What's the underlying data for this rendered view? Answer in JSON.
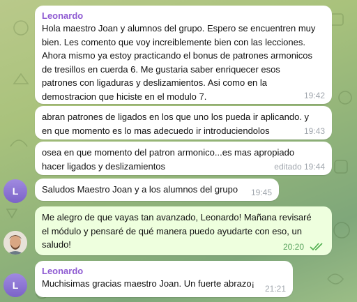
{
  "messages": [
    {
      "sender": "Leonardo",
      "lines": [
        "Hola maestro Joan y alumnos del grupo. Espero se encuentren muy",
        "bien.  Les comento que voy increiblemente bien con las lecciones.",
        "Ahora mismo ya estoy practicando el bonus de patrones armonicos",
        "de tresillos en cuerda 6. Me gustaria saber enriquecer esos",
        "patrones con ligaduras y deslizamientos. Asi como en la",
        "demostracion que hiciste en el modulo 7."
      ],
      "time": "19:42"
    },
    {
      "lines": [
        "abran patrones de ligados en los que uno los pueda ir aplicando. y",
        "en que momento es lo mas adecuedo ir introduciendolos"
      ],
      "time": "19:43"
    },
    {
      "lines": [
        "osea en que momento del patron armonico...es mas apropiado",
        "hacer ligados y deslizamientos"
      ],
      "time": "editado 19:44"
    },
    {
      "avatar": "L",
      "lines": [
        "Saludos Maestro Joan y a los alumnos del grupo"
      ],
      "time": "19:45"
    },
    {
      "lines": [
        "Me alegro de que vayas tan avanzado, Leonardo! Mañana revisaré",
        "el módulo y pensaré de qué manera puedo ayudarte con eso, un",
        "saludo!"
      ],
      "time": "20:20",
      "status_icon": "double-check-icon"
    },
    {
      "sender": "Leonardo",
      "avatar": "L",
      "lines": [
        "Muchisimas gracias maestro Joan. Un fuerte abrazo¡"
      ],
      "time": "21:21"
    }
  ],
  "colors": {
    "sender": "#8f5bd2",
    "outgoing_bubble": "#eeffde",
    "incoming_bubble": "#ffffff"
  }
}
